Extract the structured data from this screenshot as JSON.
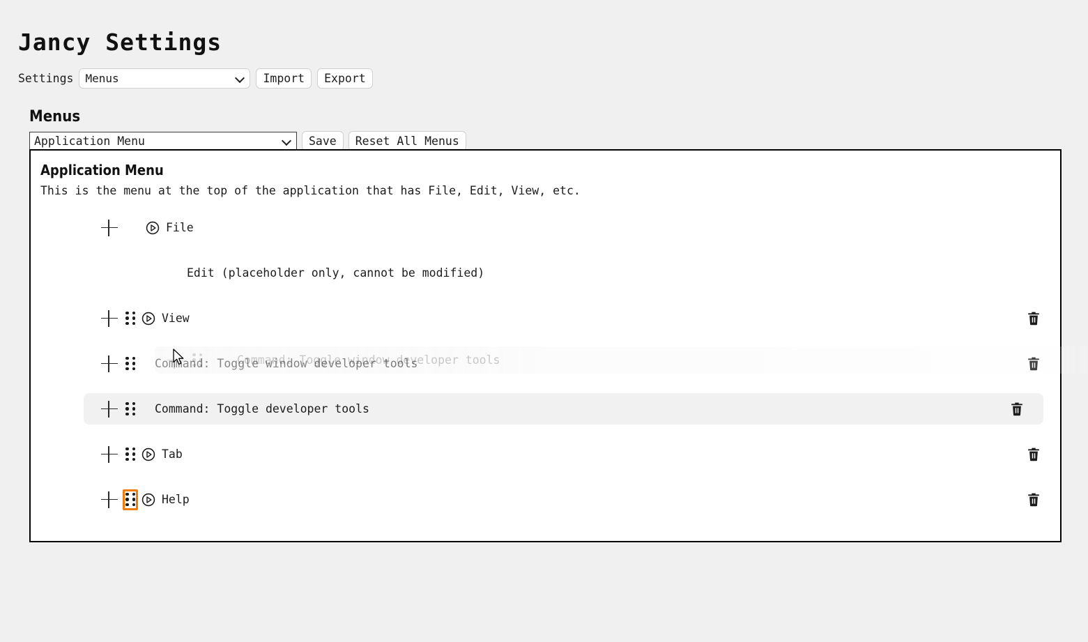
{
  "app": {
    "title": "Jancy Settings"
  },
  "settings_bar": {
    "label": "Settings",
    "select_value": "Menus",
    "select_options": [
      "Menus"
    ],
    "import_label": "Import",
    "export_label": "Export"
  },
  "menus_section": {
    "heading": "Menus",
    "select_value": "Application Menu",
    "select_options": [
      "Application Menu"
    ],
    "save_label": "Save",
    "reset_label": "Reset All Menus"
  },
  "panel": {
    "title": "Application Menu",
    "description": "This is the menu at the top of the application that has File, Edit, View, etc.",
    "rows": [
      {
        "label": "File",
        "has_plus": true,
        "has_drag": false,
        "has_expand": true,
        "has_trash": false,
        "highlight": false,
        "indent": 0
      },
      {
        "label": "Edit (placeholder only, cannot be modified)",
        "has_plus": false,
        "has_drag": false,
        "has_expand": false,
        "has_trash": false,
        "highlight": false,
        "indent": 1
      },
      {
        "label": "View",
        "has_plus": true,
        "has_drag": true,
        "has_expand": true,
        "has_trash": true,
        "highlight": false,
        "indent": 0
      },
      {
        "label": "Command: Toggle window developer tools",
        "has_plus": true,
        "has_drag": true,
        "has_expand": false,
        "has_trash": true,
        "highlight": false,
        "indent": 0
      },
      {
        "label": "Command: Toggle developer tools",
        "has_plus": true,
        "has_drag": true,
        "has_expand": false,
        "has_trash": true,
        "highlight": true,
        "indent": 0
      },
      {
        "label": "Tab",
        "has_plus": true,
        "has_drag": true,
        "has_expand": true,
        "has_trash": true,
        "highlight": false,
        "indent": 0
      },
      {
        "label": "Help",
        "has_plus": true,
        "has_drag": true,
        "has_expand": true,
        "has_trash": true,
        "highlight": false,
        "indent": 0,
        "drag_focused": true
      }
    ]
  },
  "drag_ghost": {
    "label": "Command: Toggle window developer tools"
  },
  "colors": {
    "page_background": "#f0f0f0",
    "panel_background": "#ffffff",
    "panel_border": "#000000",
    "row_highlight": "#f1f1f1",
    "focus_outline": "#f07c0a",
    "text": "#1c1c1c",
    "ghost_text": "#9a9a9a"
  },
  "icons": {
    "plus": "plus-icon",
    "drag": "drag-handle-icon",
    "expand": "expand-circle-play-icon",
    "trash": "trash-icon",
    "chevron": "chevron-down-icon",
    "cursor": "cursor-arrow-icon"
  }
}
